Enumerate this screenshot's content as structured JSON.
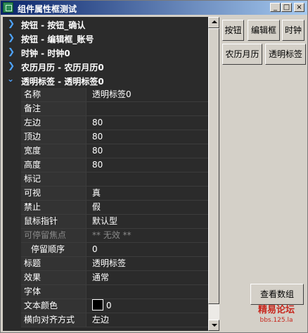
{
  "window": {
    "title": "组件属性框测试",
    "controls": {
      "minimize": "_",
      "maximize": "□",
      "close": "×"
    }
  },
  "tree": [
    {
      "label": "按钮 - 按钮_确认",
      "expanded": false
    },
    {
      "label": "按钮 - 编辑框_账号",
      "expanded": false
    },
    {
      "label": "时钟 - 时钟0",
      "expanded": false
    },
    {
      "label": "农历月历 - 农历月历0",
      "expanded": false
    },
    {
      "label": "透明标签 - 透明标签0",
      "expanded": true
    }
  ],
  "properties": [
    {
      "name": "名称",
      "value": "透明标签0"
    },
    {
      "name": "备注",
      "value": ""
    },
    {
      "name": "左边",
      "value": "80"
    },
    {
      "name": "顶边",
      "value": "80"
    },
    {
      "name": "宽度",
      "value": "80"
    },
    {
      "name": "高度",
      "value": "80"
    },
    {
      "name": "标记",
      "value": ""
    },
    {
      "name": "可视",
      "value": "真"
    },
    {
      "name": "禁止",
      "value": "假"
    },
    {
      "name": "鼠标指针",
      "value": "默认型"
    },
    {
      "name": "可停留焦点",
      "value": "** 无效 **",
      "disabled": true
    },
    {
      "name": "停留顺序",
      "value": "0",
      "indent": true
    },
    {
      "name": "标题",
      "value": "透明标签"
    },
    {
      "name": "效果",
      "value": "通常"
    },
    {
      "name": "字体",
      "value": ""
    },
    {
      "name": "文本颜色",
      "value": "0",
      "swatch": "#000000"
    },
    {
      "name": "横向对齐方式",
      "value": "左边"
    }
  ],
  "buttons": {
    "anniu": "按钮",
    "bianjikuang": "编辑框",
    "shizhong": "时钟",
    "nongliyueli": "农历月历",
    "toumingbiaoqian": "透明标签",
    "chakanshuzu": "查看数组"
  },
  "watermark": {
    "line1": "精易论坛",
    "line2": "bbs.125.la"
  },
  "colors": {
    "panel_bg": "#2b2b2b",
    "chevron": "#4ea4ff",
    "title_start": "#0a246a",
    "title_end": "#a6caf0"
  }
}
